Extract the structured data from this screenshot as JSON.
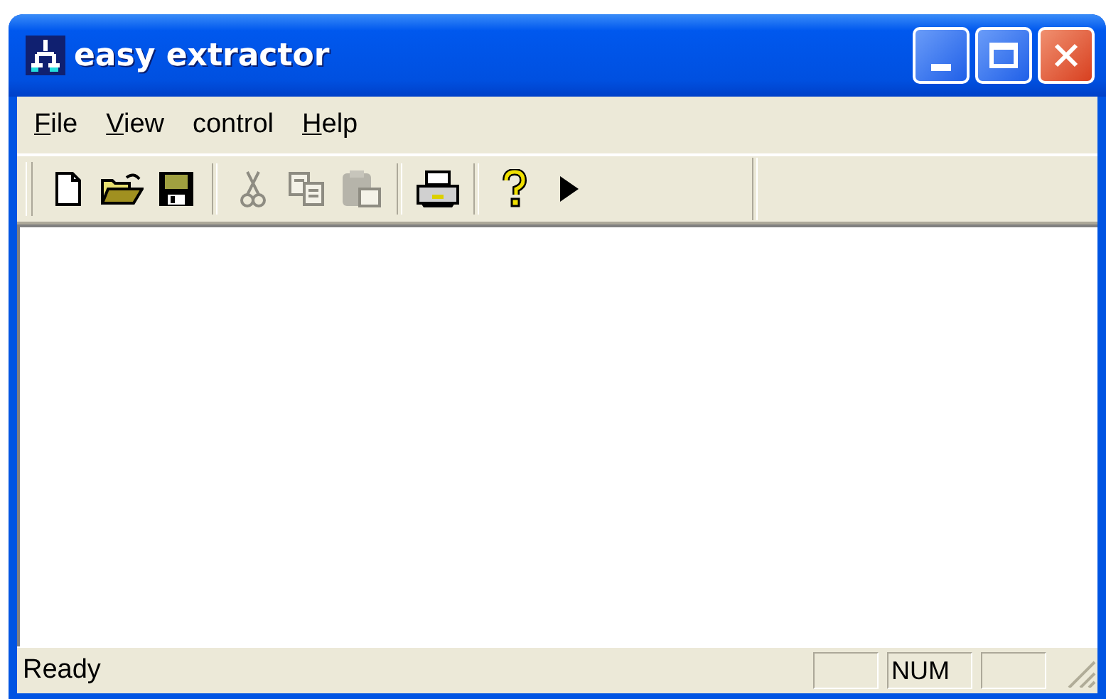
{
  "window": {
    "title": "easy extractor"
  },
  "menu": [
    {
      "label": "File",
      "underline_first": true
    },
    {
      "label": "View",
      "underline_first": true
    },
    {
      "label": "control",
      "underline_first": false
    },
    {
      "label": "Help",
      "underline_first": true
    }
  ],
  "toolbar": [
    {
      "kind": "new",
      "disabled": false
    },
    {
      "kind": "open",
      "disabled": false
    },
    {
      "kind": "save",
      "disabled": false
    },
    {
      "kind": "separator"
    },
    {
      "kind": "cut",
      "disabled": true
    },
    {
      "kind": "copy",
      "disabled": true
    },
    {
      "kind": "paste",
      "disabled": true
    },
    {
      "kind": "separator"
    },
    {
      "kind": "print",
      "disabled": false
    },
    {
      "kind": "separator"
    },
    {
      "kind": "help",
      "disabled": false
    },
    {
      "kind": "run",
      "disabled": false
    }
  ],
  "status_bar": {
    "message": "Ready",
    "panes": [
      {
        "kind": "blank"
      },
      {
        "kind": "text",
        "text": "NUM"
      },
      {
        "kind": "blank"
      }
    ]
  }
}
